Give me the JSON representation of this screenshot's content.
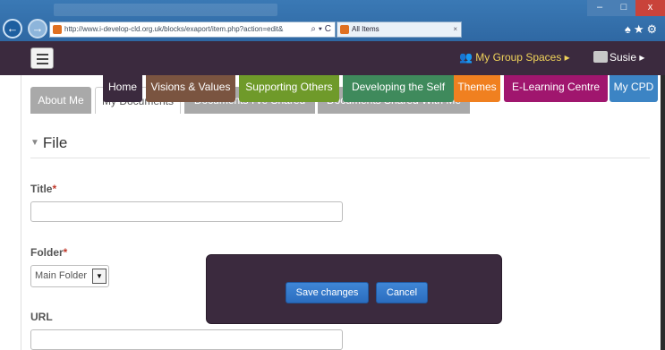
{
  "browser": {
    "address_url": "http://www.i-develop-cld.org.uk/blocks/exaport/item.php?action=edit&",
    "address_tools": "⌕ ▾ C",
    "tab_title": "All Items",
    "tab_close": "×",
    "back": "←",
    "forward": "→",
    "icons": "♠★⚙",
    "window_controls": {
      "minimize": "–",
      "maximize": "□",
      "close": "x"
    }
  },
  "topbar": {
    "menu_icon": "hamburger-icon",
    "group_spaces": "My Group Spaces ▸",
    "user": "Susie ▸"
  },
  "main_nav": [
    {
      "label": "Home",
      "color": "#3b2a3e"
    },
    {
      "label": "Visions & Values",
      "color": "#7a5440"
    },
    {
      "label": "Supporting Others",
      "color": "#6f9a2a"
    },
    {
      "label": "Developing the Self",
      "color": "#3f8a5c"
    },
    {
      "label": "Themes",
      "color": "#f08020"
    },
    {
      "label": "E-Learning Centre",
      "color": "#a0166e"
    },
    {
      "label": "My CPD",
      "color": "#3c84c4"
    }
  ],
  "sub_tabs": [
    {
      "label": "About Me"
    },
    {
      "label": "My Documents"
    },
    {
      "label": "Documents I've Shared"
    },
    {
      "label": "Documents Shared With Me"
    }
  ],
  "form": {
    "section_title": "File",
    "title_label": "Title",
    "folder_label": "Folder",
    "required_mark": "*",
    "folder_value": "Main Folder",
    "url_label": "URL"
  },
  "dialog": {
    "save_label": "Save changes",
    "cancel_label": "Cancel"
  },
  "colors": {
    "brand_dark": "#3b2a3e",
    "button_blue": "#2b6dbf",
    "required": "#c0392b"
  }
}
